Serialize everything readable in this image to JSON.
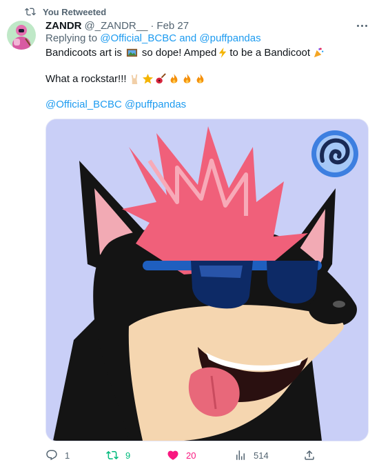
{
  "retweet": {
    "label": "You Retweeted"
  },
  "author": {
    "name": "ZANDR",
    "handle": "@_ZANDR__",
    "separator": "·",
    "date": "Feb 27"
  },
  "reply": {
    "prefix": "Replying to ",
    "mention1": "@Official_BCBC",
    "conjunction": " and ",
    "mention2": "@puffpandas"
  },
  "tweet": {
    "line1_part1": "Bandicoots art is",
    "line1_part2": "so dope! Amped",
    "line1_part3": "to be a Bandicoot",
    "line2": "What a rockstar!!!",
    "mentions": "@Official_BCBC @puffpandas"
  },
  "actions": {
    "replies": "1",
    "retweets": "9",
    "likes": "20",
    "views": "514"
  },
  "colors": {
    "link": "#1d9bf0",
    "muted": "#536471",
    "retweet_active": "#00ba7c",
    "like_active": "#f91880",
    "media_bg": "#c9cff7"
  },
  "icons": {
    "retweet": "retweet-icon",
    "more": "more-icon",
    "reply": "reply-icon",
    "like": "heart-icon",
    "views": "views-icon",
    "share": "share-icon"
  }
}
